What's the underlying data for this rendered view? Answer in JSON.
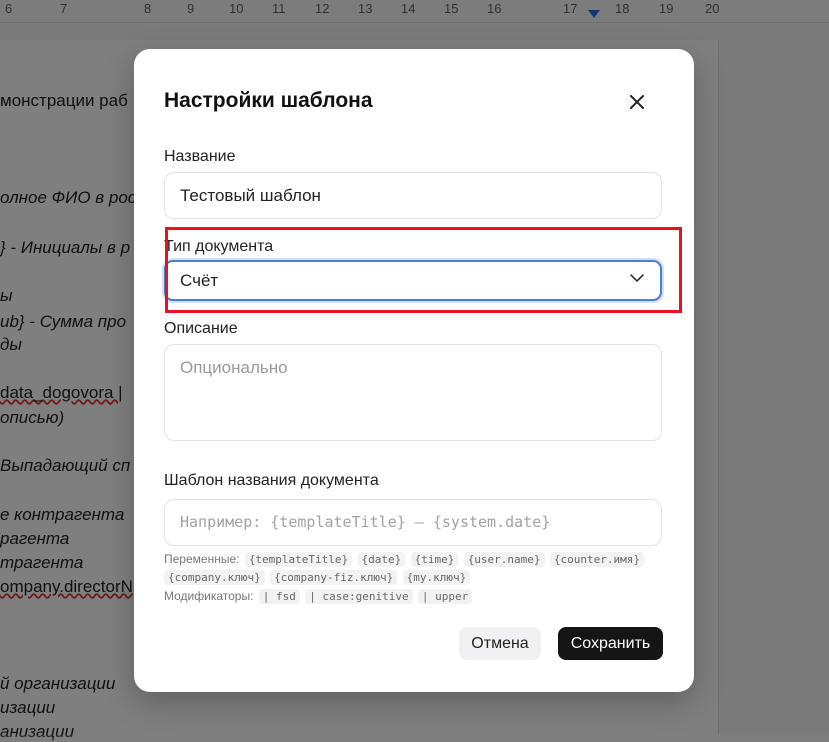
{
  "ruler": {
    "numbers": [
      "6",
      "7",
      "8",
      "9",
      "10",
      "11",
      "12",
      "13",
      "14",
      "15",
      "16",
      "17",
      "18",
      "19",
      "20"
    ]
  },
  "document": {
    "lines": [
      {
        "text": "монстрации раб",
        "italic": false
      },
      {
        "text": "олное ФИО в рос",
        "italic": true
      },
      {
        "text": "} - Инициалы в р",
        "italic": true
      },
      {
        "text": "ы",
        "italic": true
      },
      {
        "text": "ub} - Сумма про",
        "italic": true
      },
      {
        "text": "ды",
        "italic": true
      },
      {
        "text": "data_dogovora |",
        "italic": false
      },
      {
        "text": "описью)",
        "italic": true
      },
      {
        "text": "Выпадающий сп",
        "italic": true
      },
      {
        "text": "е контрагента",
        "italic": true
      },
      {
        "text": "рагента",
        "italic": true
      },
      {
        "text": "трагента",
        "italic": true
      },
      {
        "text": "ompany.directorN",
        "italic": false
      },
      {
        "text": "й организации",
        "italic": true
      },
      {
        "text": "изации",
        "italic": true
      },
      {
        "text": "анизации",
        "italic": true
      }
    ]
  },
  "modal": {
    "title": "Настройки шаблона",
    "close_icon": "close-icon",
    "name_label": "Название",
    "name_value": "Тестовый шаблон",
    "doc_type_label": "Тип документа",
    "doc_type_value": "Счёт",
    "description_label": "Описание",
    "description_placeholder": "Опционально",
    "doc_name_template_label": "Шаблон названия документа",
    "doc_name_template_placeholder": "Например: {templateTitle} — {system.date}",
    "variables_label": "Переменные:",
    "variables": [
      "{templateTitle}",
      "{date}",
      "{time}",
      "{user.name}",
      "{counter.имя}",
      "{company.ключ}",
      "{company-fiz.ключ}",
      "{my.ключ}"
    ],
    "modifiers_label": "Модификаторы:",
    "modifiers": [
      "| fsd",
      "| case:genitive",
      "| upper"
    ],
    "cancel_label": "Отмена",
    "save_label": "Сохранить"
  },
  "colors": {
    "highlight": "#e4141a",
    "focus": "#4a7fd6",
    "save_button": "#151515"
  }
}
